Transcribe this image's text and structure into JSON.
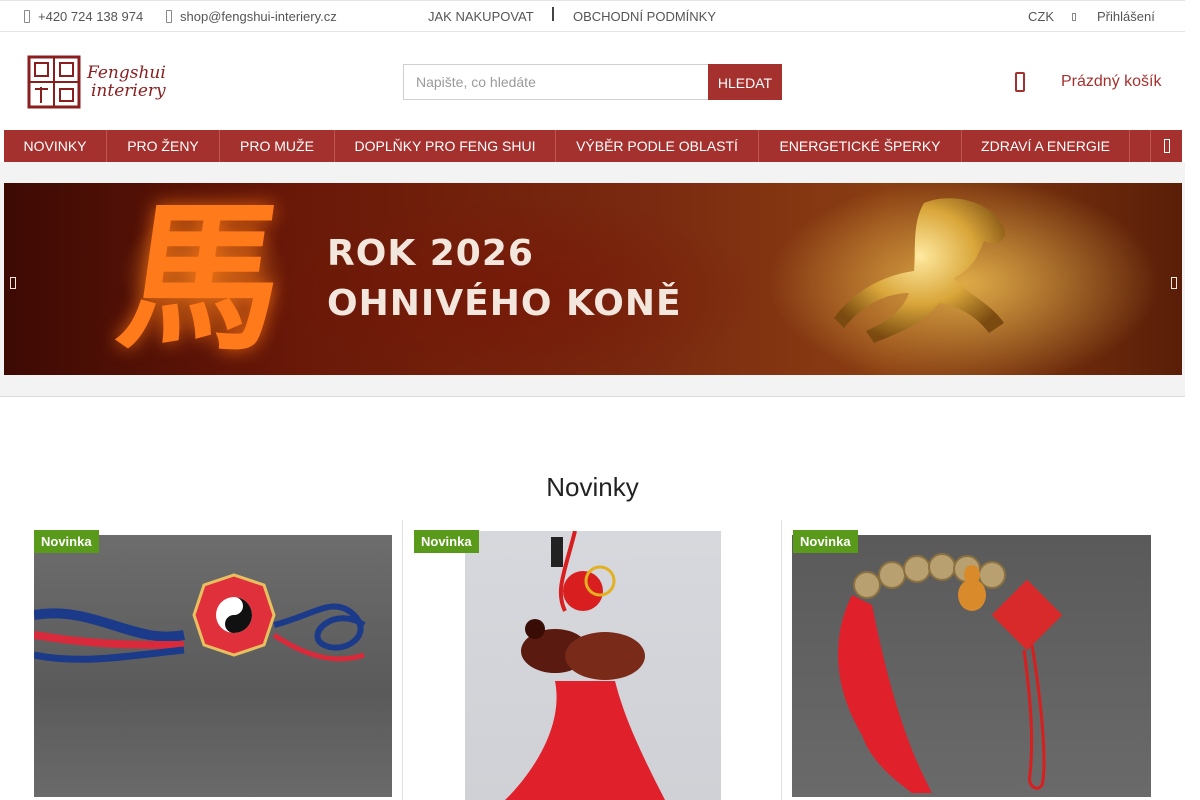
{
  "topbar": {
    "phone": "+420 724 138 974",
    "email": "shop@fengshui-interiery.cz",
    "links": [
      "JAK NAKUPOVAT",
      "OBCHODNÍ PODMÍNKY"
    ],
    "currency": "CZK",
    "login": "Přihlášení"
  },
  "header": {
    "logo_line1": "Fengshui",
    "logo_line2": "interiery",
    "search_placeholder": "Napište, co hledáte",
    "search_button": "HLEDAT",
    "cart_label": "Prázdný košík"
  },
  "nav": {
    "items": [
      "NOVINKY",
      "PRO ŽENY",
      "PRO MUŽE",
      "DOPLŇKY PRO FENG SHUI",
      "VÝBĚR PODLE OBLASTÍ",
      "ENERGETICKÉ ŠPERKY",
      "ZDRAVÍ A ENERGIE"
    ]
  },
  "banner": {
    "line1": "ROK 2026",
    "line2": "OHNIVÉHO KONĚ",
    "glyph": "馬"
  },
  "section": {
    "title": "Novinky",
    "products": [
      {
        "badge": "Novinka"
      },
      {
        "badge": "Novinka"
      },
      {
        "badge": "Novinka"
      }
    ]
  },
  "colors": {
    "brand": "#a5312f",
    "badge": "#5a9a1a"
  }
}
